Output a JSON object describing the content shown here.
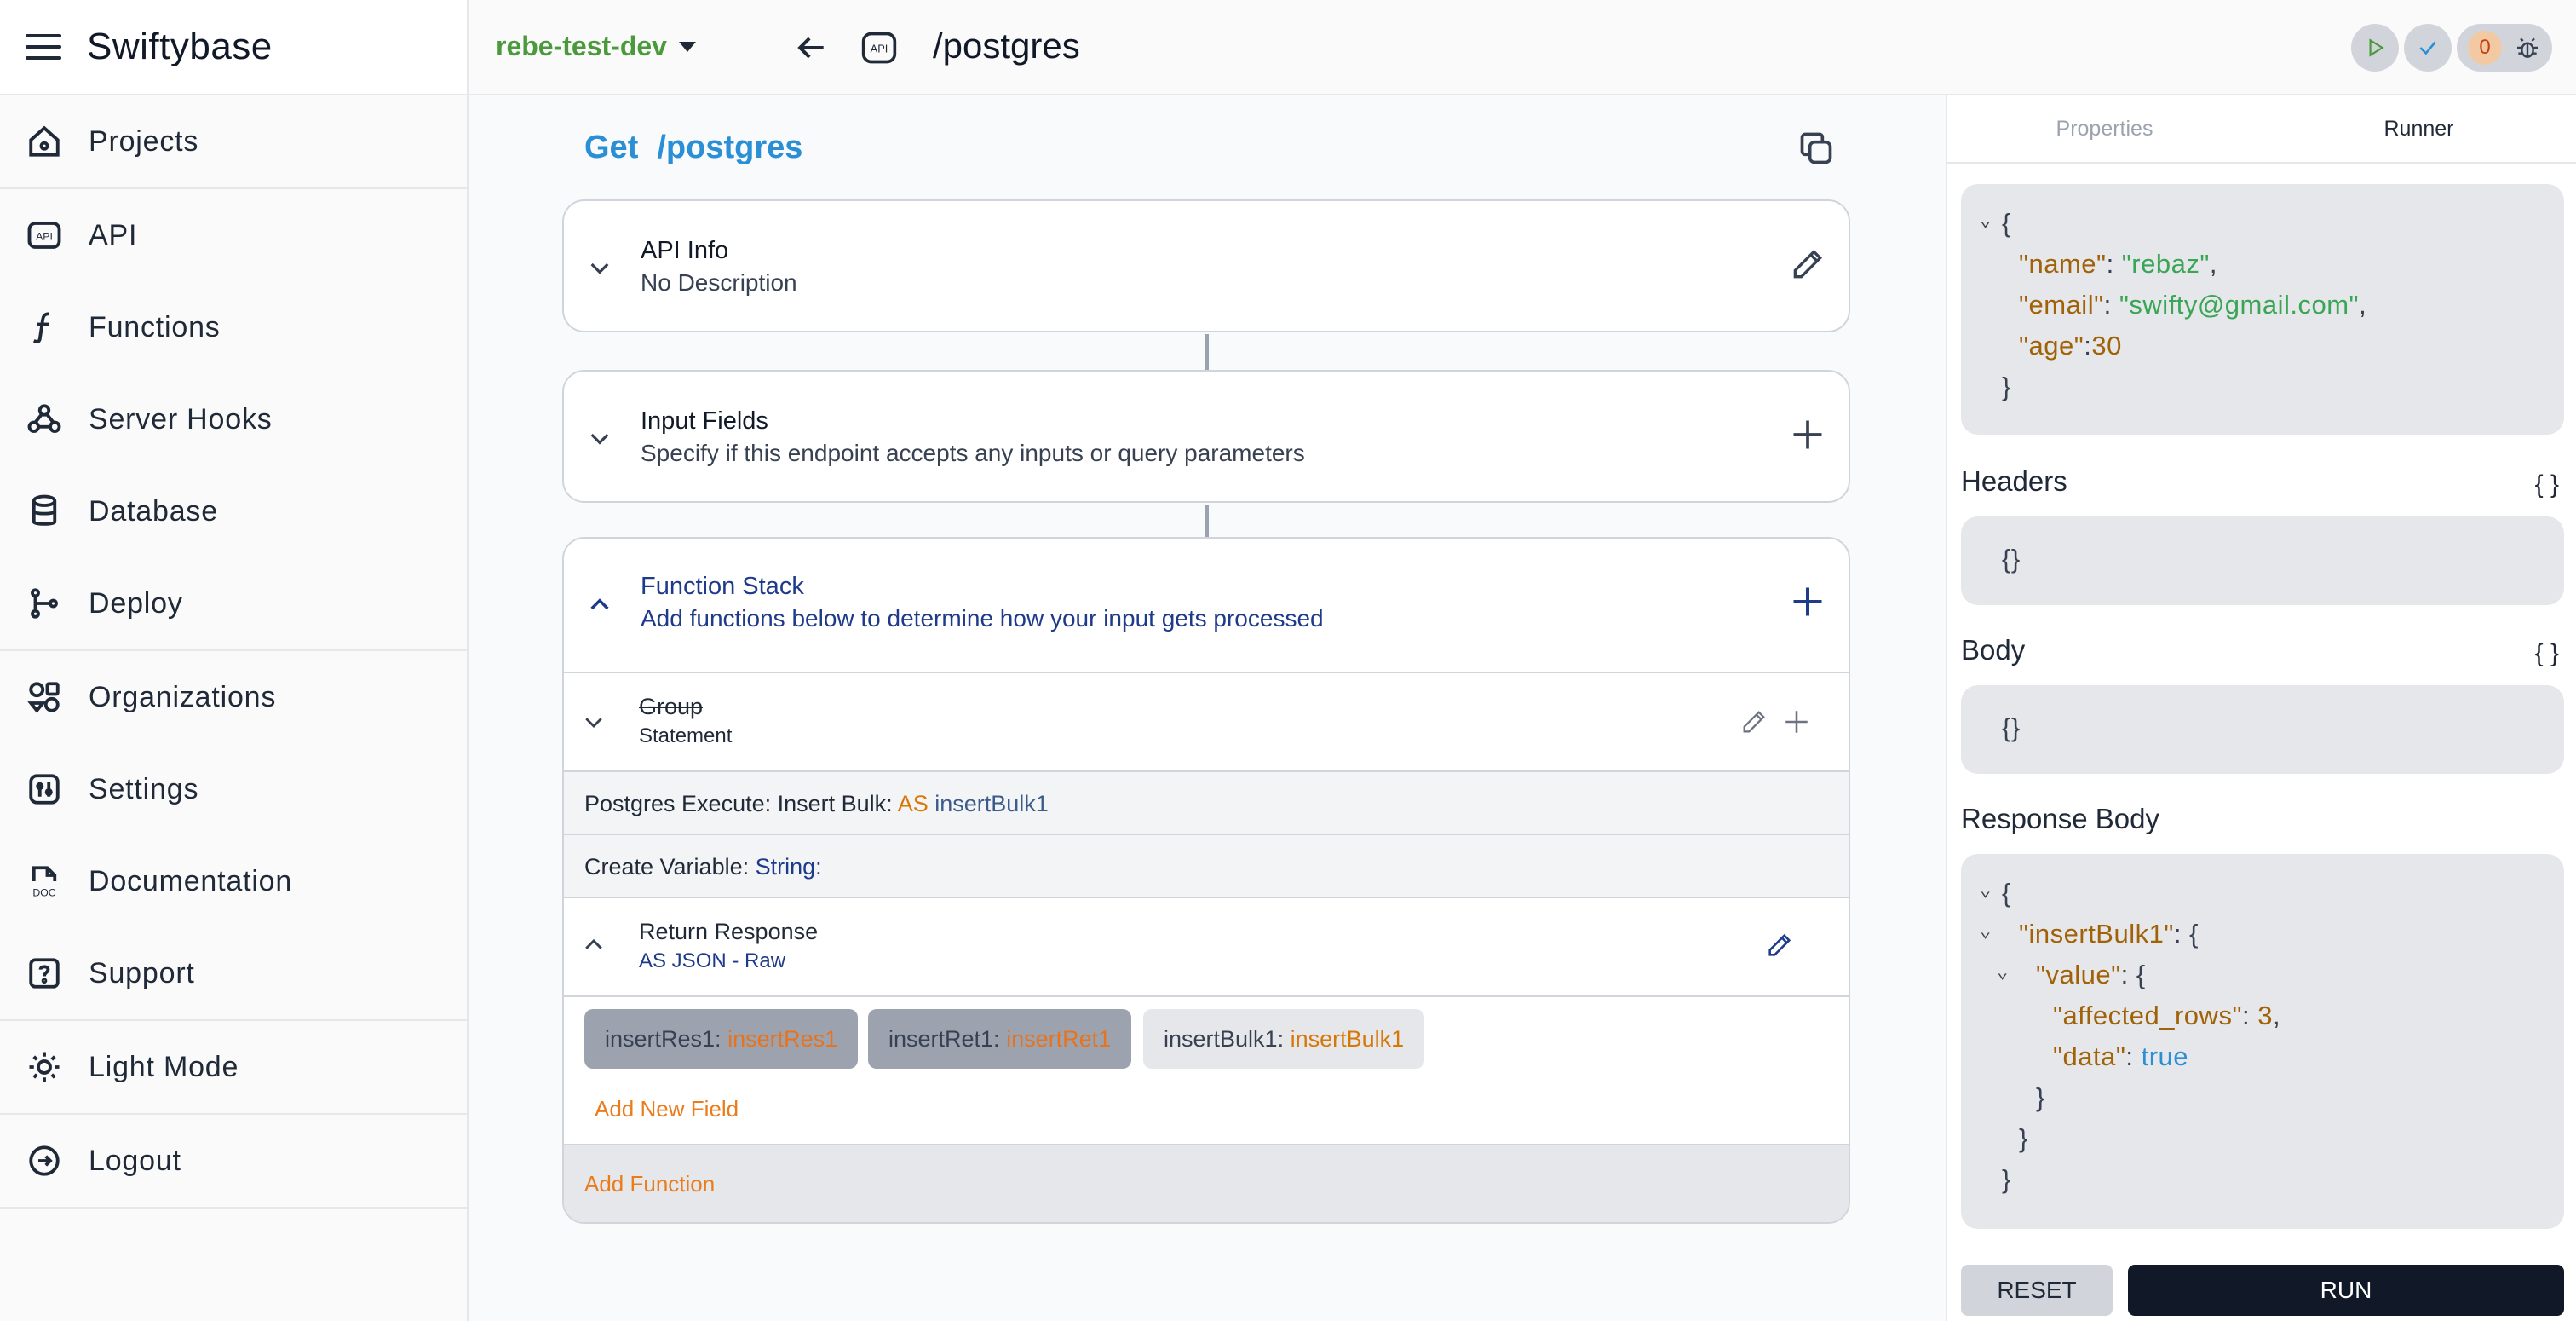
{
  "app": {
    "name": "Swiftybase"
  },
  "sidebar": {
    "items": [
      {
        "label": "Projects",
        "icon": "home-icon"
      },
      {
        "label": "API",
        "icon": "api-icon"
      },
      {
        "label": "Functions",
        "icon": "function-icon"
      },
      {
        "label": "Server Hooks",
        "icon": "webhook-icon"
      },
      {
        "label": "Database",
        "icon": "database-icon"
      },
      {
        "label": "Deploy",
        "icon": "git-branch-icon"
      },
      {
        "label": "Organizations",
        "icon": "organizations-icon"
      },
      {
        "label": "Settings",
        "icon": "settings-icon"
      },
      {
        "label": "Documentation",
        "icon": "doc-icon"
      },
      {
        "label": "Support",
        "icon": "help-icon"
      },
      {
        "label": "Light Mode",
        "icon": "sun-icon"
      },
      {
        "label": "Logout",
        "icon": "logout-icon"
      }
    ]
  },
  "topbar": {
    "workspace": "rebe-test-dev",
    "route": "/postgres",
    "api_badge": "API",
    "issue_count": "0"
  },
  "endpoint": {
    "method": "Get",
    "path": "/postgres"
  },
  "cards": {
    "api_info": {
      "title": "API Info",
      "subtitle": "No Description"
    },
    "input_fields": {
      "title": "Input Fields",
      "subtitle": "Specify if this endpoint accepts any inputs or query parameters"
    },
    "function_stack": {
      "title": "Function Stack",
      "subtitle": "Add functions below to determine how your input gets processed"
    }
  },
  "function_stack": {
    "group": {
      "title": "Group",
      "subtitle": "Statement"
    },
    "postgres_exec": {
      "prefix": "Postgres Execute: Insert Bulk:",
      "as": "AS",
      "var": "insertBulk1"
    },
    "create_var": {
      "prefix": "Create Variable:",
      "type": "String:"
    },
    "return_response": {
      "title": "Return Response",
      "subtitle": "AS JSON - Raw"
    },
    "fields": [
      {
        "key": "insertRes1:",
        "value": "insertRes1"
      },
      {
        "key": "insertRet1:",
        "value": "insertRet1"
      },
      {
        "key": "insertBulk1:",
        "value": "insertBulk1"
      }
    ],
    "add_field": "Add New Field",
    "add_function": "Add Function"
  },
  "runner": {
    "tabs": [
      "Properties",
      "Runner"
    ],
    "active_tab": "Runner",
    "request": {
      "open": "{",
      "name_key": "\"name\"",
      "name_val": "\"rebaz\"",
      "email_key": "\"email\"",
      "email_val": "\"swifty@gmail.com\"",
      "age_key": "\"age\"",
      "age_val": "30",
      "close": "}"
    },
    "headers_title": "Headers",
    "headers_value": "{}",
    "body_title": "Body",
    "body_value": "{}",
    "braces": "{ }",
    "response_title": "Response Body",
    "response": {
      "l1": "{",
      "insert_key": "\"insertBulk1\"",
      "value_key": "\"value\"",
      "affected_key": "\"affected_rows\"",
      "affected_val": "3",
      "data_key": "\"data\"",
      "data_val": "true",
      "close": "}"
    },
    "reset_label": "RESET",
    "run_label": "RUN"
  }
}
